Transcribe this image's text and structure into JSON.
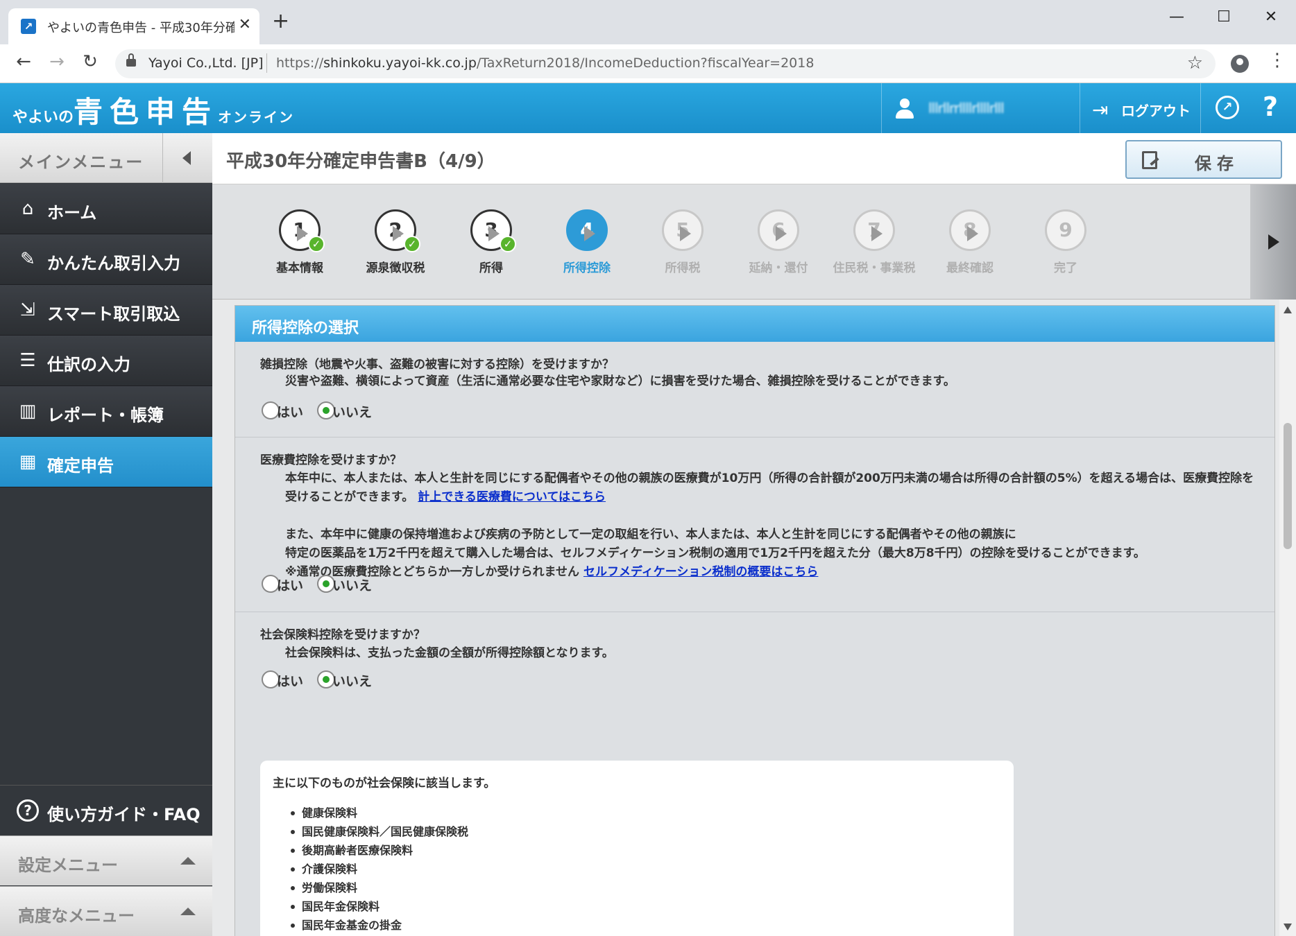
{
  "browser": {
    "tab_title": "やよいの青色申告 - 平成30年分確",
    "site_identity": "Yayoi Co.,Ltd. [JP]",
    "url_prefix": "https://",
    "url_host": "shinkoku.yayoi-kk.co.jp",
    "url_path": "/TaxReturn2018/IncomeDeduction?fiscalYear=2018"
  },
  "header": {
    "logo_prefix": "やよいの",
    "logo_main": "青色申告",
    "logo_suffix": "オンライン",
    "user_name": "lllrllrrllllrllllrlll",
    "logout_label": "ログアウト"
  },
  "sidebar": {
    "menu_title": "メインメニュー",
    "items": [
      {
        "label": "ホーム",
        "icon": "home-icon"
      },
      {
        "label": "かんたん取引入力",
        "icon": "pencil-icon"
      },
      {
        "label": "スマート取引取込",
        "icon": "import-icon"
      },
      {
        "label": "仕訳の入力",
        "icon": "journal-icon"
      },
      {
        "label": "レポート・帳簿",
        "icon": "report-icon"
      },
      {
        "label": "確定申告",
        "icon": "tax-return-icon"
      }
    ],
    "active_index": 5,
    "guide_label": "使い方ガイド・FAQ",
    "settings_menu": "設定メニュー",
    "advanced_menu": "高度なメニュー"
  },
  "page": {
    "title": "平成30年分確定申告書B（4/9）",
    "save_label": "保存"
  },
  "steps": [
    {
      "num": "1",
      "label": "基本情報",
      "state": "done"
    },
    {
      "num": "2",
      "label": "源泉徴収税",
      "state": "done"
    },
    {
      "num": "3",
      "label": "所得",
      "state": "done"
    },
    {
      "num": "4",
      "label": "所得控除",
      "state": "current"
    },
    {
      "num": "5",
      "label": "所得税",
      "state": "future"
    },
    {
      "num": "6",
      "label": "延納・還付",
      "state": "future"
    },
    {
      "num": "7",
      "label": "住民税・事業税",
      "state": "future"
    },
    {
      "num": "8",
      "label": "最終確認",
      "state": "future"
    },
    {
      "num": "9",
      "label": "完了",
      "state": "future"
    }
  ],
  "panel": {
    "title": "所得控除の選択",
    "yes_label": "はい",
    "no_label": "いいえ",
    "q1": {
      "title": "雑損控除（地震や火事、盗難の被害に対する控除）を受けますか？",
      "desc": "災害や盗難、横領によって資産（生活に通常必要な住宅や家財など）に損害を受けた場合、雑損控除を受けることができます。",
      "selected": "いいえ"
    },
    "q2": {
      "title": "医療費控除を受けますか？",
      "desc1": "本年中に、本人または、本人と生計を同じにする配偶者やその他の親族の医療費が10万円（所得の合計額が200万円未満の場合は所得の合計額の5%）を超える場合は、医療費控除を受けることができます。",
      "link1": "計上できる医療費についてはこちら",
      "desc2": "また、本年中に健康の保持増進および疾病の予防として一定の取組を行い、本人または、本人と生計を同じにする配偶者やその他の親族に",
      "desc3": "特定の医薬品を1万2千円を超えて購入した場合は、セルフメディケーション税制の適用で1万2千円を超えた分（最大8万8千円）の控除を受けることができます。",
      "desc4": "※通常の医療費控除とどちらか一方しか受けられません",
      "link2": "セルフメディケーション税制の概要はこちら",
      "selected": "いいえ"
    },
    "q3": {
      "title": "社会保険料控除を受けますか？",
      "desc": "社会保険料は、支払った金額の全額が所得控除額となります。",
      "selected": "いいえ",
      "info_title": "主に以下のものが社会保険に該当します。",
      "info_items": [
        "健康保険料",
        "国民健康保険料／国民健康保険税",
        "後期高齢者医療保険料",
        "介護保険料",
        "労働保険料",
        "国民年金保険料",
        "国民年金基金の掛金"
      ]
    }
  }
}
